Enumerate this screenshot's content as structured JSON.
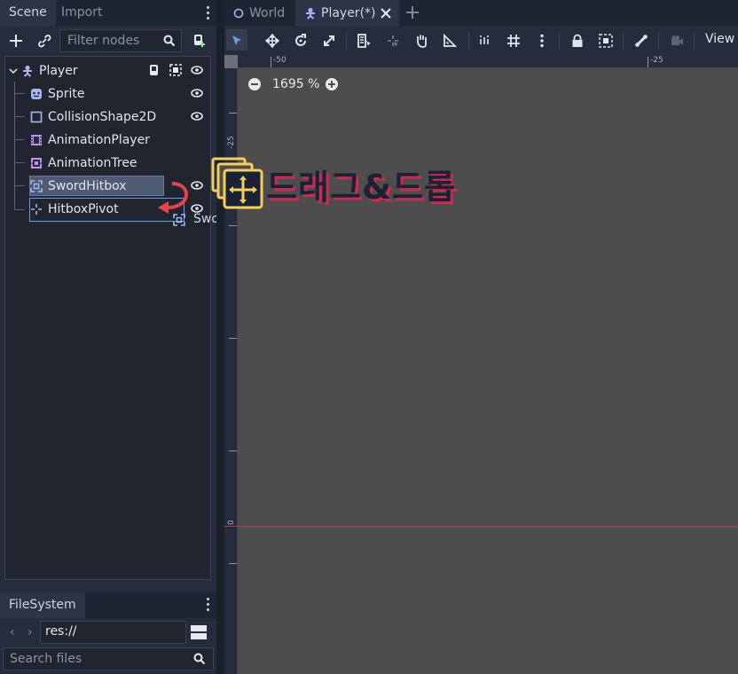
{
  "left_dock": {
    "tabs": [
      {
        "label": "Scene",
        "active": true
      },
      {
        "label": "Import",
        "active": false
      }
    ],
    "filter_placeholder": "Filter nodes",
    "tree": [
      {
        "label": "Player",
        "icon": "player-node-icon",
        "depth": 0,
        "expanded": true,
        "visible": true
      },
      {
        "label": "Sprite",
        "icon": "sprite-node-icon",
        "depth": 1,
        "visible": true
      },
      {
        "label": "CollisionShape2D",
        "icon": "collision-shape-icon",
        "depth": 1,
        "visible": true
      },
      {
        "label": "AnimationPlayer",
        "icon": "animation-player-icon",
        "depth": 1
      },
      {
        "label": "AnimationTree",
        "icon": "animation-tree-icon",
        "depth": 1
      },
      {
        "label": "SwordHitbox",
        "icon": "area2d-icon",
        "depth": 1,
        "visible": true,
        "selected": true
      },
      {
        "label": "HitboxPivot",
        "icon": "position2d-icon",
        "depth": 1,
        "visible": true
      }
    ],
    "drag_ghost_label": "SwordHitbox"
  },
  "filesystem": {
    "tab_label": "FileSystem",
    "path": "res://",
    "search_placeholder": "Search files"
  },
  "main_tabs": [
    {
      "label": "World",
      "active": false
    },
    {
      "label": "Player(*)",
      "active": true
    }
  ],
  "viewport": {
    "view_menu": "View",
    "zoom_level": "1695 %",
    "ruler_top_labels": [
      "-50",
      "-25"
    ],
    "ruler_left_labels": [
      "-25",
      "0"
    ]
  },
  "overlay": {
    "caption": "드래그&드롭"
  },
  "colors": {
    "accent": "#699ce8",
    "selection": "#4f5b74",
    "arrow": "#e0434e",
    "drag_icon": "#f5cf5b",
    "caption_shadow": "#d0284f",
    "origin_line": "#b83a47"
  }
}
